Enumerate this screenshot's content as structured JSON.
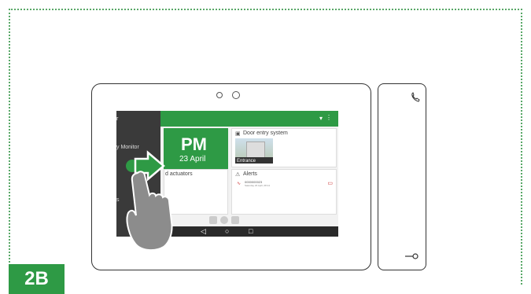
{
  "badge": "2B",
  "screen": {
    "drawer_items": [
      "y Monitor",
      "s"
    ],
    "clock": {
      "time": "PM",
      "date": "23 April"
    },
    "door_entry": {
      "title": "Door entry system",
      "camera_label": "Entrance"
    },
    "actuators": {
      "title": "d actuators"
    },
    "alerts": {
      "title": "Alerts",
      "item": "0000000023",
      "subtext": "Saturday 23 April, 08:14"
    }
  },
  "colors": {
    "green": "#2e9a45",
    "frame": "#58a867"
  },
  "icons": [
    "handset-icon",
    "key-icon",
    "back-icon",
    "home-icon",
    "recents-icon",
    "arrow-right-icon",
    "hand-icon"
  ]
}
